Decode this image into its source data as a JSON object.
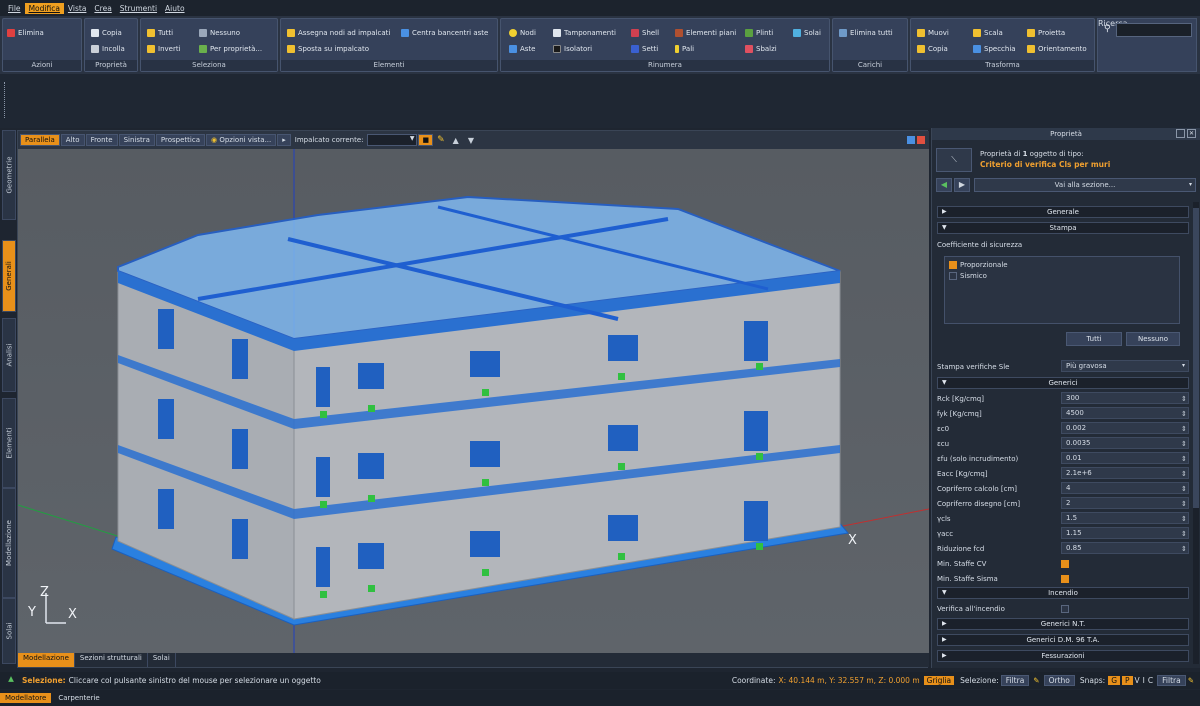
{
  "menu": [
    "File",
    "Modifica",
    "Vista",
    "Crea",
    "Strumenti",
    "Aiuto"
  ],
  "menu_active": "Modifica",
  "ribbon": {
    "azioni": {
      "label": "Azioni",
      "items": [
        "Elimina"
      ]
    },
    "proprieta": {
      "label": "Proprietà",
      "items": [
        "Copia",
        "Incolla"
      ]
    },
    "seleziona": {
      "label": "Seleziona",
      "items": [
        "Tutti",
        "Nessuno",
        "Inverti",
        "Per proprietà..."
      ]
    },
    "elementi": {
      "label": "Elementi",
      "items": [
        "Assegna nodi ad impalcati",
        "Centra bancentri aste",
        "Sposta su impalcato"
      ]
    },
    "rinumera": {
      "label": "Rinumera",
      "items": [
        "Nodi",
        "Tamponamenti",
        "Shell",
        "Elementi piani",
        "Plinti",
        "Solai",
        "Aste",
        "Isolatori",
        "Setti",
        "Pali",
        "Sbalzi"
      ]
    },
    "carichi": {
      "label": "Carichi",
      "items": [
        "Elimina tutti"
      ]
    },
    "trasforma": {
      "label": "Trasforma",
      "items": [
        "Muovi",
        "Scala",
        "Proietta",
        "Copia",
        "Specchia",
        "Orientamento"
      ]
    },
    "ricerca": {
      "label": "Ricerca"
    }
  },
  "colors": {
    "accent": "#e8901a",
    "panel": "#232b37",
    "building_glass": "#2a7de0"
  },
  "vtabs": [
    "Geometrie",
    "Generali",
    "Analisi",
    "Elementi",
    "Modellazione",
    "Solai"
  ],
  "vtab_active": "Generali",
  "viewport": {
    "views": [
      "Parallela",
      "Alto",
      "Fronte",
      "Sinistra",
      "Prospettica"
    ],
    "view_active": "Parallela",
    "options_label": "Opzioni vista...",
    "impalcato_label": "Impalcato corrente:",
    "axes": {
      "z": "Z",
      "y": "Y",
      "x": "X",
      "x_far": "X"
    },
    "bottom_tabs": [
      "Modellazione",
      "Sezioni strutturali",
      "Solai"
    ],
    "bottom_active": "Modellazione"
  },
  "panel": {
    "title": "Proprietà",
    "object_line1": "Proprietà di",
    "object_count": "1",
    "object_line1b": "oggetto di tipo:",
    "object_type": "Criterio di verifica Cls per muri",
    "goto": "Vai alla sezione...",
    "sections": {
      "generale": "Generale",
      "stampa": "Stampa",
      "generici": "Generici",
      "incendio": "Incendio",
      "generici_nt": "Generici N.T.",
      "generici_dm": "Generici D.M. 96 T.A.",
      "fessurazioni": "Fessurazioni"
    },
    "coeff_label": "Coefficiente di sicurezza",
    "coeff_options": [
      {
        "label": "Proporzionale",
        "checked": true
      },
      {
        "label": "Sismico",
        "checked": false
      }
    ],
    "btn_tutti": "Tutti",
    "btn_nessuno": "Nessuno",
    "stampa_label": "Stampa verifiche Sle",
    "stampa_value": "Più gravosa",
    "generici": [
      {
        "label": "Rck [Kg/cmq]",
        "value": "300"
      },
      {
        "label": "fyk [Kg/cmq]",
        "value": "4500"
      },
      {
        "label": "εc0",
        "value": "0.002"
      },
      {
        "label": "εcu",
        "value": "0.0035"
      },
      {
        "label": "εfu (solo incrudimento)",
        "value": "0.01"
      },
      {
        "label": "Eacc [Kg/cmq]",
        "value": "2.1e+6"
      },
      {
        "label": "Copriferro calcolo [cm]",
        "value": "4"
      },
      {
        "label": "Copriferro disegno [cm]",
        "value": "2"
      },
      {
        "label": "γcls",
        "value": "1.5"
      },
      {
        "label": "γacc",
        "value": "1.15"
      },
      {
        "label": "Riduzione fcd",
        "value": "0.85"
      }
    ],
    "min_staffe_cv": "Min. Staffe CV",
    "min_staffe_sisma": "Min. Staffe Sisma",
    "verifica_incendio": "Verifica all'incendio"
  },
  "status": {
    "label": "Selezione:",
    "message": "Cliccare col pulsante sinistro del mouse per selezionare un oggetto",
    "coords_label": "Coordinate:",
    "coords_value": "X: 40.144 m, Y: 32.557 m, Z: 0.000 m",
    "griglia": "Griglia",
    "selezione_label": "Selezione:",
    "filtra": "Filtra",
    "ortho": "Ortho",
    "snaps": "Snaps:",
    "snap_g": "G",
    "snap_p": "P",
    "snap_v": "V",
    "snap_i": "I",
    "snap_c": "C",
    "filtra2": "Filtra"
  },
  "bottom_tabs": [
    "Modellatore",
    "Carpenterie"
  ],
  "bottom_active": "Modellatore"
}
